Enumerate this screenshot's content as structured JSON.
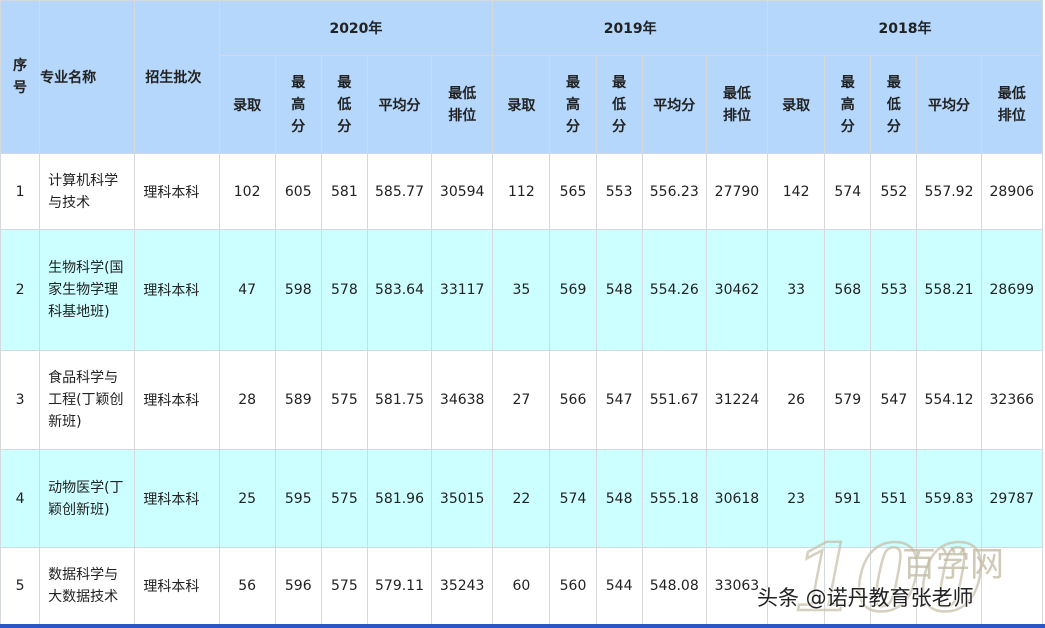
{
  "headers": {
    "index": "序号",
    "major": "专业名称",
    "batch": "招生批次",
    "years": [
      "2020年",
      "2019年",
      "2018年"
    ],
    "sub": [
      "录取",
      "最高分",
      "最低分",
      "平均分",
      "最低排位"
    ]
  },
  "rows": [
    {
      "index": "1",
      "major": "计算机科学与技术",
      "batch": "理科本科",
      "y2020": [
        "102",
        "605",
        "581",
        "585.77",
        "30594"
      ],
      "y2019": [
        "112",
        "565",
        "553",
        "556.23",
        "27790"
      ],
      "y2018": [
        "142",
        "574",
        "552",
        "557.92",
        "28906"
      ]
    },
    {
      "index": "2",
      "major": "生物科学(国家生物学理科基地班)",
      "batch": "理科本科",
      "y2020": [
        "47",
        "598",
        "578",
        "583.64",
        "33117"
      ],
      "y2019": [
        "35",
        "569",
        "548",
        "554.26",
        "30462"
      ],
      "y2018": [
        "33",
        "568",
        "553",
        "558.21",
        "28699"
      ]
    },
    {
      "index": "3",
      "major": "食品科学与工程(丁颖创新班)",
      "batch": "理科本科",
      "y2020": [
        "28",
        "589",
        "575",
        "581.75",
        "34638"
      ],
      "y2019": [
        "27",
        "566",
        "547",
        "551.67",
        "31224"
      ],
      "y2018": [
        "26",
        "579",
        "547",
        "554.12",
        "32366"
      ]
    },
    {
      "index": "4",
      "major": "动物医学(丁颖创新班)",
      "batch": "理科本科",
      "y2020": [
        "25",
        "595",
        "575",
        "581.96",
        "35015"
      ],
      "y2019": [
        "22",
        "574",
        "548",
        "555.18",
        "30618"
      ],
      "y2018": [
        "23",
        "591",
        "551",
        "559.83",
        "29787"
      ]
    },
    {
      "index": "5",
      "major": "数据科学与大数据技术",
      "batch": "理科本科",
      "y2020": [
        "56",
        "596",
        "575",
        "579.11",
        "35243"
      ],
      "y2019": [
        "60",
        "560",
        "544",
        "548.08",
        "33063"
      ],
      "y2018": [
        "",
        "",
        "",
        "",
        ""
      ]
    }
  ],
  "watermark": {
    "logo_digits": "100",
    "logo_text": "百学网",
    "credit": "头条 @诺丹教育张老师"
  }
}
